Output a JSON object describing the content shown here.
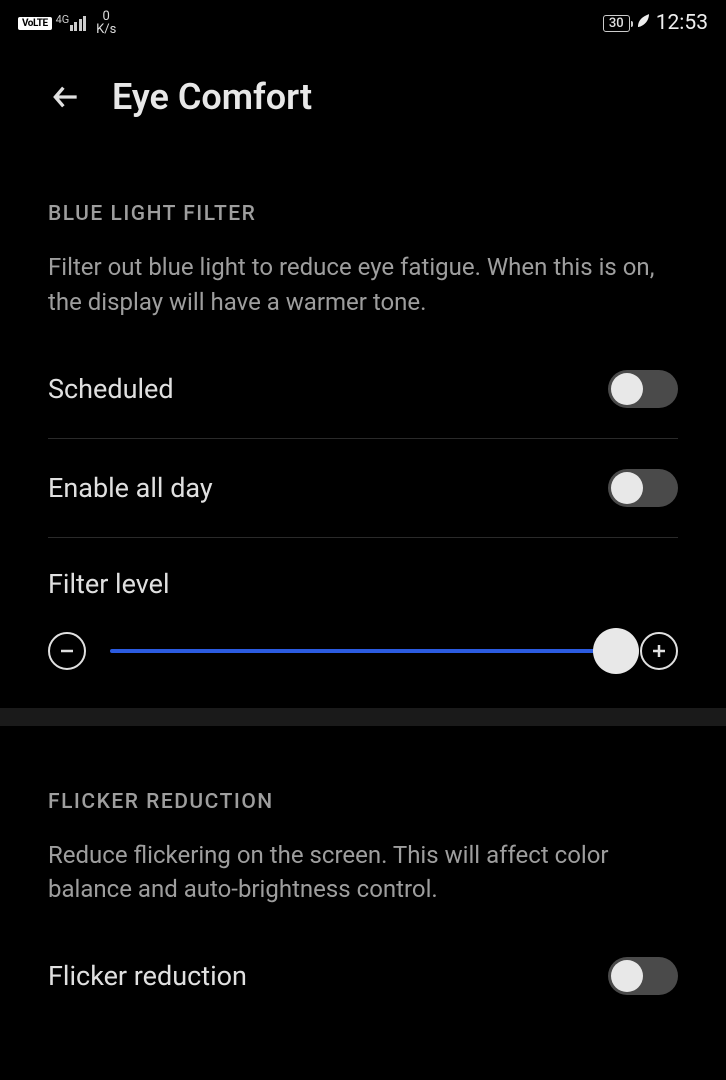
{
  "status_bar": {
    "volte": "VoLTE",
    "network": "4G",
    "speed_value": "0",
    "speed_unit": "K/s",
    "battery": "30",
    "clock": "12:53"
  },
  "header": {
    "title": "Eye Comfort"
  },
  "sections": {
    "blue_light": {
      "heading": "BLUE LIGHT FILTER",
      "description": "Filter out blue light to reduce eye fatigue. When this is on, the display will have a warmer tone.",
      "scheduled_label": "Scheduled",
      "enable_all_day_label": "Enable all day",
      "filter_level_label": "Filter level"
    },
    "flicker": {
      "heading": "FLICKER REDUCTION",
      "description": "Reduce flickering on the screen. This will affect color balance and auto-brightness control.",
      "flicker_reduction_label": "Flicker reduction"
    }
  }
}
